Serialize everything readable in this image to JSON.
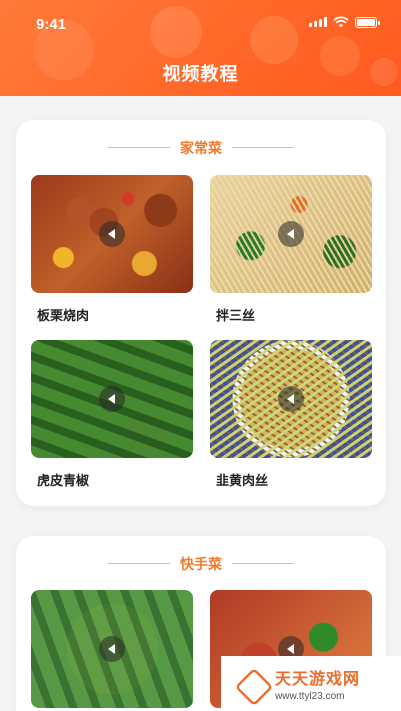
{
  "status_bar": {
    "time": "9:41"
  },
  "header": {
    "title": "视频教程"
  },
  "sections": [
    {
      "title": "家常菜",
      "items": [
        {
          "label": "板栗烧肉"
        },
        {
          "label": "拌三丝"
        },
        {
          "label": "虎皮青椒"
        },
        {
          "label": "韭黄肉丝"
        }
      ]
    },
    {
      "title": "快手菜"
    }
  ],
  "watermark": {
    "name": "天天游戏网",
    "url": "www.ttyl23.com"
  },
  "colors": {
    "accent": "#ff6a2a",
    "section_title": "#f07a2a"
  }
}
